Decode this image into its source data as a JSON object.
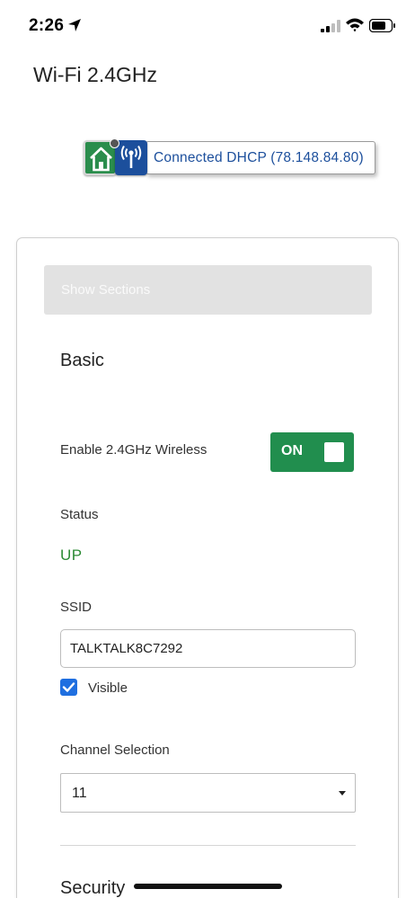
{
  "status_bar": {
    "time": "2:26"
  },
  "page": {
    "title": "Wi-Fi 2.4GHz"
  },
  "connection": {
    "text": "Connected DHCP (78.148.84.80)"
  },
  "card": {
    "show_sections_label": "Show Sections",
    "basic": {
      "title": "Basic",
      "enable_label": "Enable 2.4GHz Wireless",
      "toggle_label": "ON",
      "status_label": "Status",
      "status_value": "UP",
      "ssid_label": "SSID",
      "ssid_value": "TALKTALK8C7292",
      "visible_label": "Visible",
      "visible_checked": true,
      "channel_label": "Channel Selection",
      "channel_value": "11"
    },
    "security": {
      "title": "Security"
    }
  },
  "colors": {
    "toggle_green": "#218e4e",
    "status_green": "#2b8a33",
    "link_blue": "#1c4f9c",
    "checkbox_blue": "#1f6fe0",
    "home_green": "#2a8d4c"
  },
  "icons": [
    "location-arrow-icon",
    "cellular-signal-icon",
    "wifi-icon",
    "battery-icon",
    "home-icon",
    "antenna-icon",
    "checkmark-icon",
    "chevron-down-icon"
  ]
}
